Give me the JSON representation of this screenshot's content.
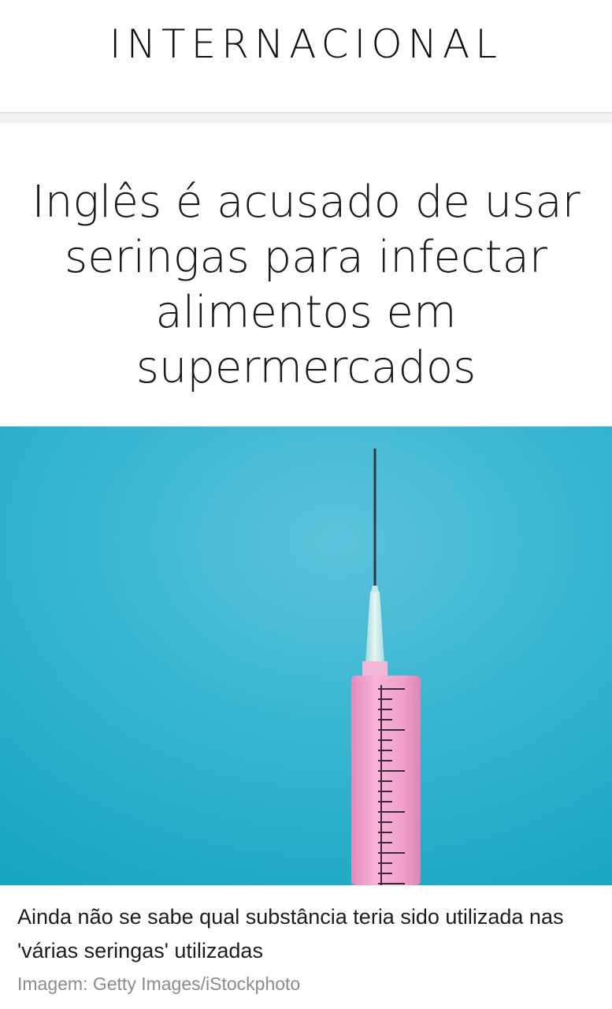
{
  "section": {
    "title": "INTERNACIONAL"
  },
  "article": {
    "headline": "Inglês é acusado de usar seringas para infectar alimentos em supermercados",
    "image": {
      "description_icon": "syringe-photo",
      "caption": "Ainda não se sabe qual substância teria sido utilizada nas 'várias seringas' utilizadas",
      "credit": "Imagem: Getty Images/iStockphoto"
    }
  },
  "colors": {
    "background": "#ffffff",
    "text": "#1b1b1b",
    "credit_text": "#8c8c8c",
    "photo_background": "#2fb4cf",
    "syringe_barrel": "#f09cc8"
  }
}
